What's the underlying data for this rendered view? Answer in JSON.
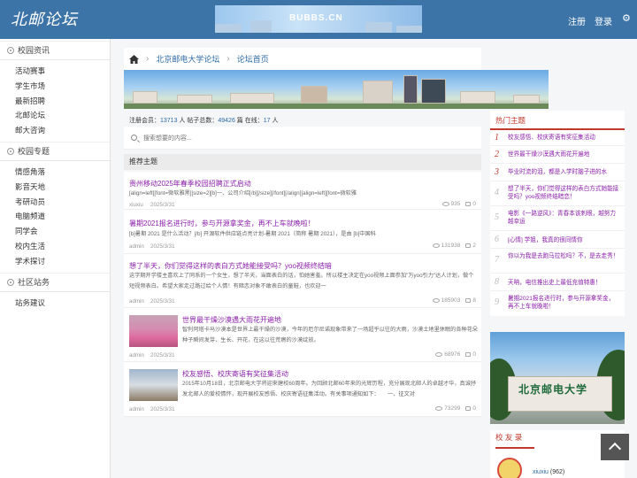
{
  "header": {
    "logo": "北邮论坛",
    "banner_text": "BUBBS.CN",
    "register": "注册",
    "login": "登录"
  },
  "sidebar": {
    "sections": [
      {
        "title": "校园资讯",
        "items": [
          "活动赛事",
          "学生市场",
          "最新招聘",
          "北邮论坛",
          "邮大咨询"
        ]
      },
      {
        "title": "校园专题",
        "items": [
          "情感角落",
          "影音天地",
          "考研动员",
          "电脑频道",
          "同学会",
          "校内生活",
          "学术探讨"
        ]
      },
      {
        "title": "社区站务",
        "items": [
          "站务建议"
        ]
      }
    ]
  },
  "breadcrumb": {
    "items": [
      "北京邮电大学论坛",
      "论坛首页"
    ]
  },
  "stats": {
    "members_label": "注册会员：",
    "members": "13713",
    "posts_label": "人 帖子总数：",
    "posts": "49426",
    "online_label": "篇 在线：",
    "online": "17",
    "unit": "人"
  },
  "search": {
    "placeholder": "搜索想要的内容..."
  },
  "recommended": {
    "title": "推荐主题",
    "posts": [
      {
        "title": "贵州移动2025年春季校园招聘正式启动",
        "summary": "[align=left][font=微软雅黑][size=2][b]一、公司介绍[/b][/size][/font][/align][align=left][font=微软雅",
        "author": "xiuxiu",
        "date": "2025/3/31",
        "views": "935",
        "comments": "0"
      },
      {
        "title": "暑期2021报名进行时，参与开源拿奖金，再不上车就晚啦！",
        "summary": "[b]暑期 2021 是什么活动？[/b] 开源软件供应链点亮计划-暑期 2021（简称 暑期 2021），是由 [b]中国科",
        "author": "admin",
        "date": "2025/3/31",
        "views": "131938",
        "comments": "2"
      },
      {
        "title": "想了半天，你们觉得这样的表白方式她能接受吗？yoo视频终结暗",
        "summary": "这学期开学楼主喜欢上了同系的一个女生，想了半天，当面表白的话，怕她害羞。所以楼主决定在yoo视频上面参加\"万yoo引力\"达人计划，做个短视频表白。希望大家走过路过给个人情！有暗恋对象不敢表白的童鞋，也欢迎一",
        "author": "admin",
        "date": "2025/3/31",
        "views": "185903",
        "comments": "8"
      },
      {
        "title": "世界最干燥沙漠遇大雨花开遍地",
        "summary": "智利阿塔卡马沙漠本是世界上最干燥的沙漠，今年的厄尔尼诺现象带来了一场超乎以往的大雨，沙漠土地里休眠的各种花朵种子瞬间发芽、生长、开花，在这以往荒瘠的沙漠绽放。",
        "author": "admin",
        "date": "2025/3/31",
        "views": "68976",
        "comments": "0"
      },
      {
        "title": "校友感悟、校庆寄语有奖征集活动",
        "summary": "2015年10月18日，北京邮电大学将迎来建校60周年。为回顾北邮60年来的光辉历程，充分展现北邮人的卓越才华，真诚抒发北邮人的爱校情怀，现开展校友感悟、校庆寄语征集活动。有关事项通知如下：　　一、征文对",
        "author": "admin",
        "date": "2025/3/31",
        "views": "73299",
        "comments": "0"
      }
    ]
  },
  "hot": {
    "title": "热门主题",
    "items": [
      {
        "num": "1",
        "text": "校友感悟、校庆寄语有奖征集活动"
      },
      {
        "num": "2",
        "text": "世界最干燥沙漠遇大雨花开遍地"
      },
      {
        "num": "3",
        "text": "毕业时流的泪，都是入学时脑子进的水"
      },
      {
        "num": "4",
        "text": "想了半天，你们觉得这样的表白方式她能接受吗？yoo视频终结暗恋！"
      },
      {
        "num": "5",
        "text": "电影《一路逆风》：青春本该刺眼，越努力越幸运"
      },
      {
        "num": "6",
        "text": "[心情] 学姐，我真的很同情你"
      },
      {
        "num": "7",
        "text": "你以为我是去跑马拉松吗？不，是去走秀！"
      },
      {
        "num": "8",
        "text": "天呐，电信推出史上最低充值特惠！"
      },
      {
        "num": "9",
        "text": "暑期2021报名进行时，参与开源拿奖金，再不上车就晚啦！"
      }
    ],
    "image_text": "北京邮电大学"
  },
  "friends": {
    "title": "校 友 录",
    "user": "xiuxiu",
    "count": "(962)"
  }
}
